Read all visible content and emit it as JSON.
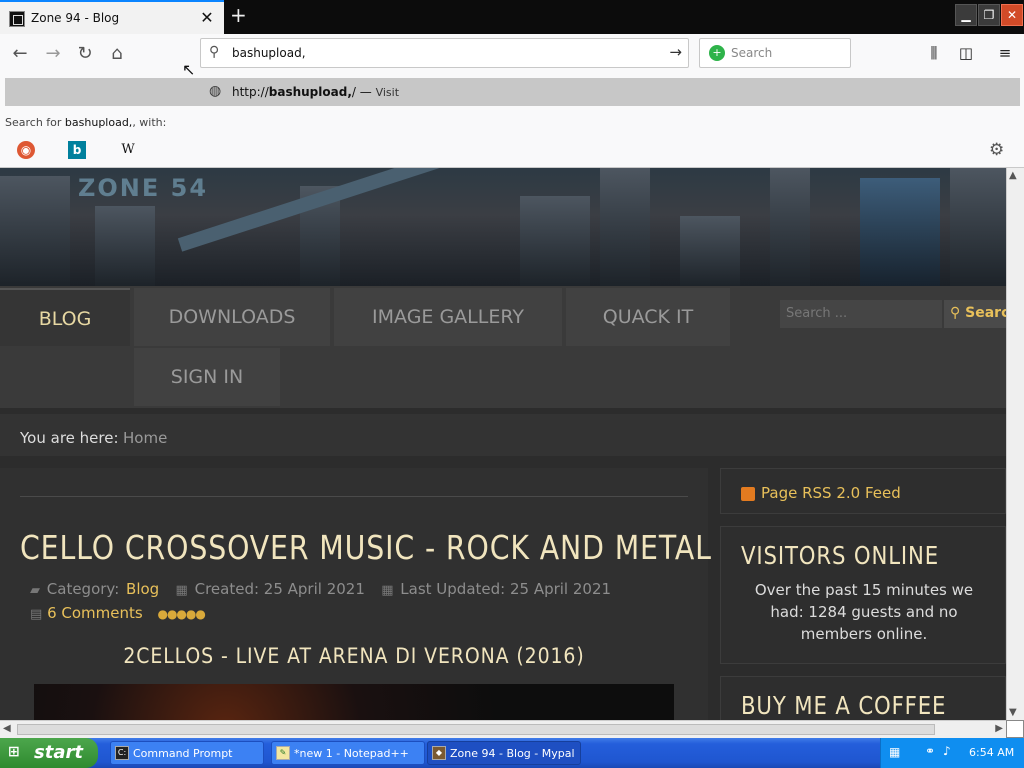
{
  "browser": {
    "tab_title": "Zone 94 - Blog",
    "url_value": "bashupload,",
    "search_placeholder": "Search",
    "suggestion_prefix": "http://",
    "suggestion_domain": "bashupload,",
    "suggestion_suffix": "/",
    "suggestion_action": "Visit",
    "search_for_prefix": "Search for",
    "search_for_term": "bashupload,",
    "search_for_suffix": ", with:",
    "engines": [
      "DuckDuckGo",
      "Bing",
      "Wikipedia"
    ],
    "engine_glyphs": {
      "ddg": "◉",
      "bing": "b",
      "wiki": "W"
    }
  },
  "site": {
    "logo": "ZONE 54",
    "menu": [
      "BLOG",
      "DOWNLOADS",
      "IMAGE GALLERY",
      "QUACK IT",
      "SIGN IN"
    ],
    "search_placeholder": "Search ...",
    "search_button": "Search",
    "breadcrumb_label": "You are here:",
    "breadcrumb_home": "Home"
  },
  "article": {
    "title": "CELLO CROSSOVER MUSIC - ROCK AND METAL",
    "category_label": "Category:",
    "category": "Blog",
    "created": "Created: 25 April 2021",
    "updated": "Last Updated: 25 April 2021",
    "comments": "6 Comments",
    "rating": 5,
    "subtitle": "2CELLOS - LIVE AT ARENA DI VERONA (2016)"
  },
  "sidebar": {
    "rss": "Page RSS 2.0 Feed",
    "visitors_heading": "VISITORS ONLINE",
    "visitors_text": "Over the past 15 minutes we had: 1284 guests and no members online.",
    "coffee_heading": "BUY ME A COFFEE"
  },
  "taskbar": {
    "start": "start",
    "items": [
      "Command Prompt",
      "*new 1 - Notepad++",
      "Zone 94 - Blog - Mypal"
    ],
    "clock": "6:54 AM"
  },
  "colors": {
    "accent": "#e8c05a",
    "heading": "#f1e5be",
    "tab_accent": "#0a84ff"
  }
}
